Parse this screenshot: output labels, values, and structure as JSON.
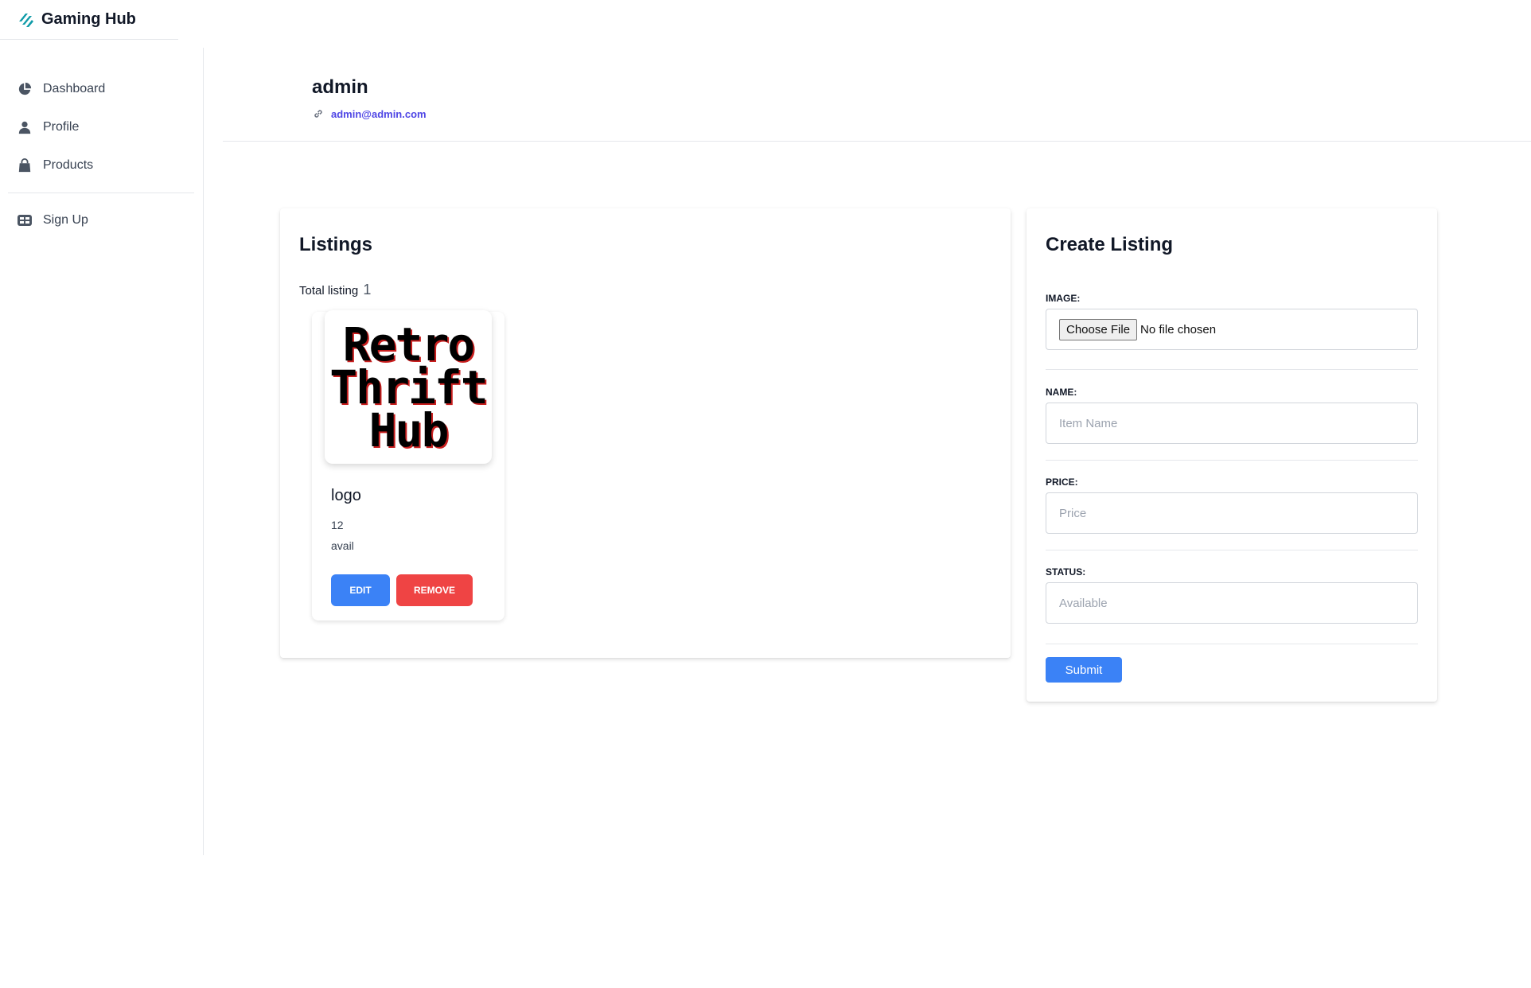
{
  "brand": {
    "name": "Gaming Hub",
    "logo_icon": "diagonal-stripes-logo",
    "accent": "#0f9ba8"
  },
  "sidebar": {
    "items": [
      {
        "label": "Dashboard",
        "icon": "pie-chart-icon"
      },
      {
        "label": "Profile",
        "icon": "user-icon"
      },
      {
        "label": "Products",
        "icon": "shopping-bag-icon"
      },
      {
        "label": "Sign Up",
        "icon": "table-icon"
      }
    ]
  },
  "profile": {
    "username": "admin",
    "email": "admin@admin.com",
    "email_icon": "link-icon"
  },
  "listings": {
    "title": "Listings",
    "total_label": "Total listing",
    "total_count": "1",
    "items": [
      {
        "image_text": [
          "Retro",
          "Thrift",
          "Hub"
        ],
        "name": "logo",
        "price": "12",
        "status": "avail",
        "edit_label": "EDIT",
        "remove_label": "REMOVE"
      }
    ]
  },
  "create_listing": {
    "title": "Create Listing",
    "image_label": "IMAGE:",
    "file_button": "Choose File",
    "file_status": "No file chosen",
    "name_label": "NAME:",
    "name_placeholder": "Item Name",
    "price_label": "PRICE:",
    "price_placeholder": "Price",
    "status_label": "STATUS:",
    "status_placeholder": "Available",
    "submit_label": "Submit"
  },
  "colors": {
    "primary": "#3b82f6",
    "danger": "#ef4444",
    "link": "#4f46e5"
  }
}
